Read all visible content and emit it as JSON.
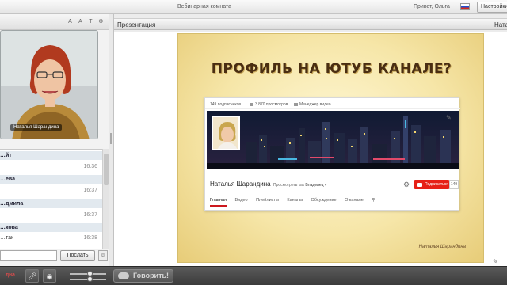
{
  "topbar": {
    "room_title": "Вебинарная комната",
    "greeting": "Привет, Ольга",
    "settings_label": "Настройки"
  },
  "left_panel": {
    "header_icons": [
      "font-decrease-icon",
      "font-increase-icon",
      "text-icon",
      "settings-icon"
    ],
    "header_glyphs": [
      "A",
      "A",
      "T",
      "⚙"
    ],
    "video": {
      "speaker_name": "Наталья Шарандина"
    },
    "chat": {
      "messages": [
        {
          "name": "…йт",
          "text": "",
          "time": "16:36"
        },
        {
          "name": "…ева",
          "text": "",
          "time": "16:37"
        },
        {
          "name": "…дмила",
          "text": "",
          "time": "16:37"
        },
        {
          "name": "…кова",
          "text": "…так",
          "time": "16:38"
        }
      ],
      "input_placeholder": "",
      "send_label": "Послать"
    }
  },
  "presentation": {
    "header_title": "Презентация",
    "header_user": "Натальи",
    "slide": {
      "title": "ПРОФИЛЬ НА ЮТУБ  КАНАЛЕ?",
      "author": "Наталья Шарандина",
      "youtube": {
        "stats": [
          "149 подписчиков",
          "3 870 просмотров",
          "Менеджер видео"
        ],
        "channel_name": "Наталья Шарандина",
        "view_as_label": "Просмотреть как",
        "view_as_value": "Владелец",
        "subscribe_label": "Подписаться",
        "subscribe_count": "149",
        "tabs": [
          "Главная",
          "Видео",
          "Плейлисты",
          "Каналы",
          "Обсуждение",
          "О канале"
        ]
      }
    }
  },
  "bottombar": {
    "status_text": "…дна",
    "speak_label": "Говорить!",
    "volume_mic": 0.55,
    "volume_speaker": 0.55
  },
  "colors": {
    "accent_red": "#e62117",
    "slide_title": "#4a2e12",
    "chat_name_bg": "#e2e9ef"
  }
}
